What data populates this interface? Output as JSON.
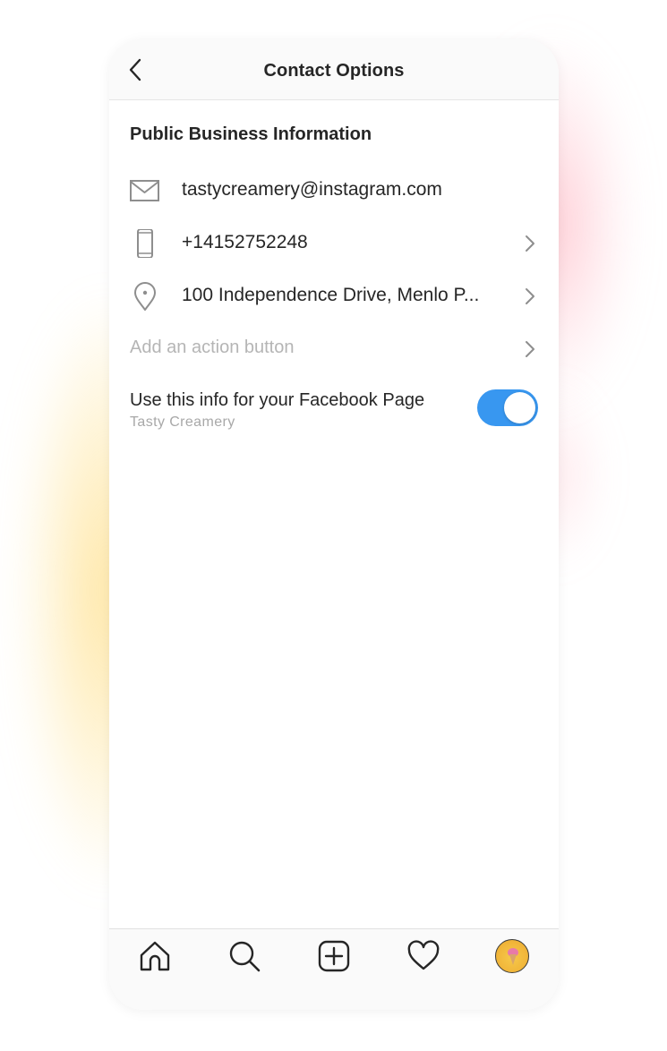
{
  "header": {
    "title": "Contact Options",
    "back_icon": "chevron-left-icon"
  },
  "section": {
    "title": "Public Business Information"
  },
  "rows": {
    "email": {
      "icon": "envelope-icon",
      "label": "tastycreamery@instagram.com"
    },
    "phone": {
      "icon": "phone-icon",
      "label": "+14152752248"
    },
    "address": {
      "icon": "location-pin-icon",
      "label": "100 Independence Drive, Menlo P..."
    },
    "action": {
      "label": "Add an action button"
    }
  },
  "facebook": {
    "label": "Use this info for your Facebook Page",
    "page_name": "Tasty Creamery",
    "toggle_on": true,
    "toggle_color": "#3897f0"
  },
  "tabbar": {
    "items": [
      "home-icon",
      "search-icon",
      "add-post-icon",
      "heart-icon",
      "profile-avatar"
    ]
  },
  "colors": {
    "accent": "#3897f0",
    "text": "#262626",
    "muted": "#b5b5b5"
  }
}
